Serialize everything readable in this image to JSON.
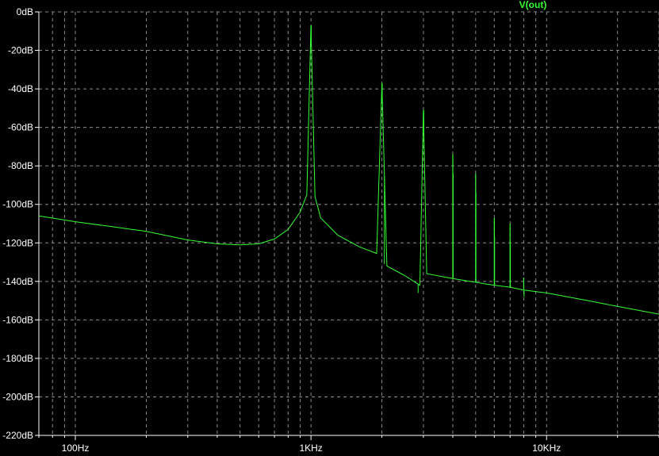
{
  "chart_data": {
    "type": "line",
    "x_scale": "log",
    "xlim": [
      70,
      30000
    ],
    "ylim": [
      -220,
      0
    ],
    "grid": true,
    "legend": "top-right",
    "y_ticks": [
      {
        "value": 0,
        "label": "0dB"
      },
      {
        "value": -20,
        "label": "-20dB"
      },
      {
        "value": -40,
        "label": "-40dB"
      },
      {
        "value": -60,
        "label": "-60dB"
      },
      {
        "value": -80,
        "label": "-80dB"
      },
      {
        "value": -100,
        "label": "-100dB"
      },
      {
        "value": -120,
        "label": "-120dB"
      },
      {
        "value": -140,
        "label": "-140dB"
      },
      {
        "value": -160,
        "label": "-160dB"
      },
      {
        "value": -180,
        "label": "-180dB"
      },
      {
        "value": -200,
        "label": "-200dB"
      },
      {
        "value": -220,
        "label": "-220dB"
      }
    ],
    "x_ticks": [
      {
        "value": 100,
        "label": "100Hz"
      },
      {
        "value": 1000,
        "label": "1KHz"
      },
      {
        "value": 10000,
        "label": "10KHz"
      }
    ],
    "series": [
      {
        "name": "V(out)",
        "color": "#33ff33",
        "baseline": [
          [
            70,
            -106
          ],
          [
            100,
            -109
          ],
          [
            200,
            -114
          ],
          [
            300,
            -118.5
          ],
          [
            400,
            -120.5
          ],
          [
            500,
            -121
          ],
          [
            600,
            -120.5
          ],
          [
            700,
            -118
          ],
          [
            800,
            -113
          ],
          [
            900,
            -104
          ],
          [
            960,
            -95
          ],
          [
            1000,
            -7
          ],
          [
            1040,
            -96
          ],
          [
            1100,
            -107
          ],
          [
            1300,
            -116
          ],
          [
            1600,
            -122
          ],
          [
            1900,
            -125.5
          ],
          [
            2000,
            -37
          ],
          [
            2100,
            -132
          ],
          [
            2500,
            -137
          ],
          [
            2900,
            -142
          ],
          [
            3000,
            -51
          ],
          [
            3100,
            -136
          ],
          [
            4000,
            -138.5
          ],
          [
            5000,
            -140.5
          ],
          [
            6000,
            -142
          ],
          [
            7000,
            -143
          ],
          [
            8000,
            -144.5
          ],
          [
            10000,
            -146
          ],
          [
            15000,
            -150
          ],
          [
            20000,
            -153
          ],
          [
            30000,
            -157
          ]
        ],
        "harmonics": [
          {
            "f": 1000,
            "peak": -7
          },
          {
            "f": 2000,
            "peak": -37
          },
          {
            "f": 3000,
            "peak": -51
          },
          {
            "f": 4000,
            "peak": -74
          },
          {
            "f": 5000,
            "peak": -84
          },
          {
            "f": 6000,
            "peak": -107
          },
          {
            "f": 7000,
            "peak": -110
          },
          {
            "f": 8000,
            "peak": -138
          }
        ],
        "dips": [
          {
            "f": 2850,
            "value": -146
          },
          {
            "f": 2050,
            "value": -131
          }
        ]
      }
    ]
  }
}
